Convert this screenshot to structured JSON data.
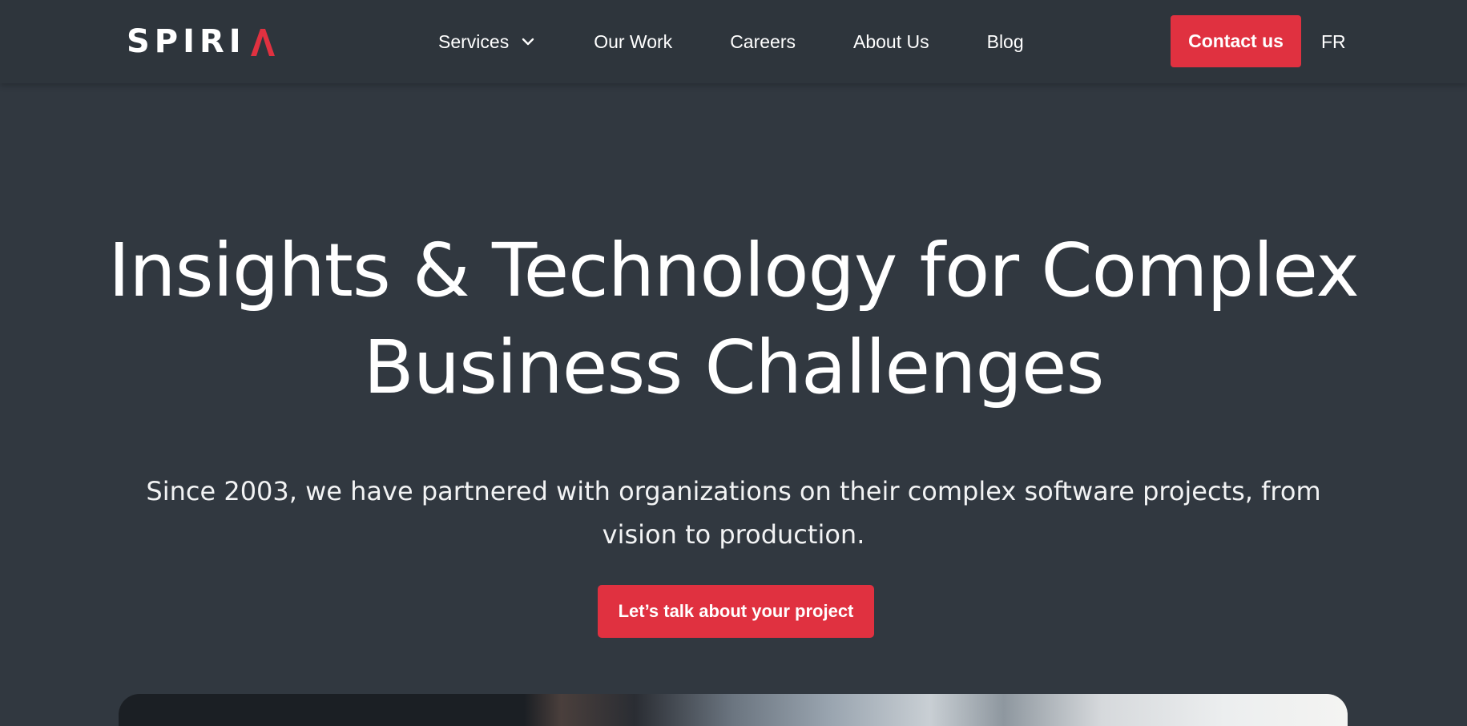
{
  "header": {
    "logo_text": "SPIRI",
    "logo_mark_color": "#e03140",
    "nav": [
      {
        "label": "Services",
        "has_dropdown": true
      },
      {
        "label": "Our Work"
      },
      {
        "label": "Careers"
      },
      {
        "label": "About Us"
      },
      {
        "label": "Blog"
      }
    ],
    "contact_label": "Contact us",
    "language_label": "FR"
  },
  "hero": {
    "title_lines": [
      "Insights & Technology for Complex",
      "Business Challenges"
    ],
    "subtitle_lines": [
      "Since 2003, we have partnered with organizations on their complex software projects, from",
      "vision to production."
    ],
    "cta_label": "Let’s talk about your project"
  },
  "colors": {
    "background": "#313840",
    "header_background": "#2e353c",
    "accent": "#e03140",
    "text": "#ffffff"
  },
  "icons": {
    "services_dropdown": "chevron-down-icon",
    "logo_mark": "red-chevron-a-mark"
  }
}
